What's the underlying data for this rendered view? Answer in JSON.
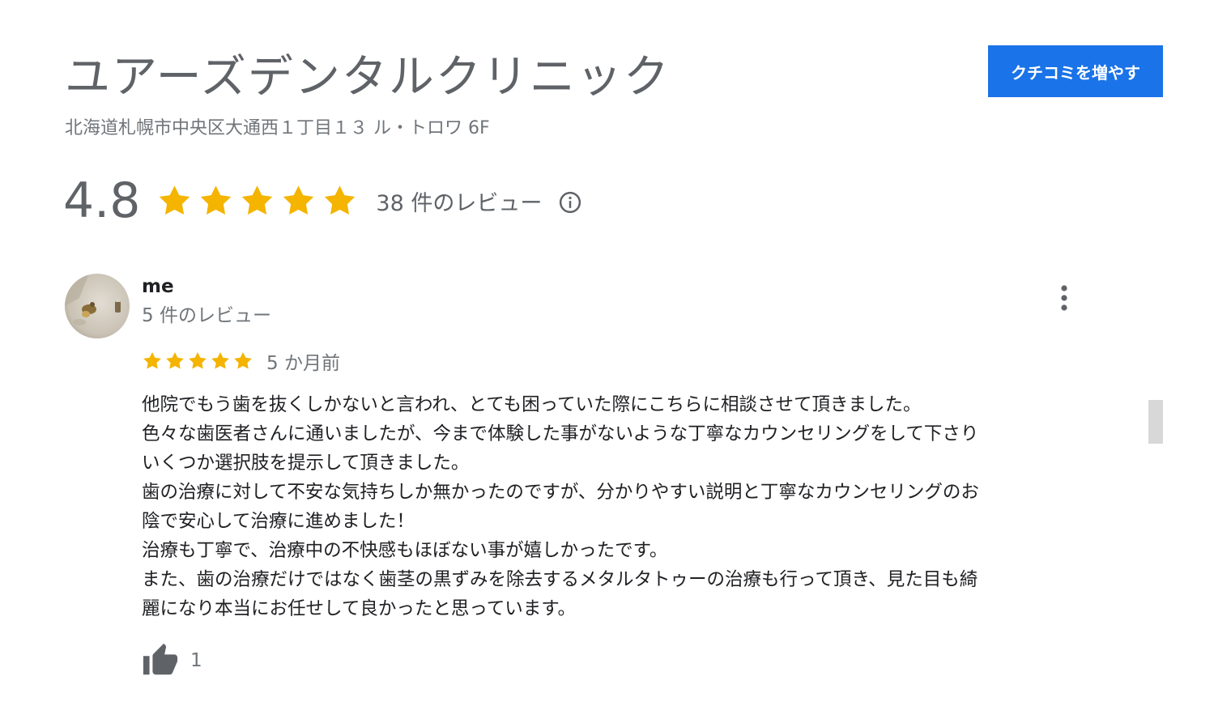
{
  "business": {
    "name": "ユアーズデンタルクリニック",
    "address": "北海道札幌市中央区大通西１丁目１３ ル・トロワ 6F"
  },
  "cta": {
    "label": "クチコミを増やす"
  },
  "rating": {
    "score": "4.8",
    "stars": 5,
    "review_count_label": "38 件のレビュー"
  },
  "review": {
    "author": "me",
    "author_meta": "5 件のレビュー",
    "stars": 5,
    "date": "5 か月前",
    "text": "他院でもう歯を抜くしかないと言われ、とても困っていた際にこちらに相談させて頂きました。\n色々な歯医者さんに通いましたが、今まで体験した事がないような丁寧なカウンセリングをして下さり\nいくつか選択肢を提示して頂きました。\n歯の治療に対して不安な気持ちしか無かったのですが、分かりやすい説明と丁寧なカウンセリングのお\n陰で安心して治療に進めました！\n治療も丁寧で、治療中の不快感もほぼない事が嬉しかったです。\nまた、歯の治療だけではなく歯茎の黒ずみを除去するメタルタトゥーの治療も行って頂き、見た目も綺\n麗になり本当にお任せして良かったと思っています。",
    "likes": "1"
  },
  "colors": {
    "star": "#f4b400",
    "accent_button": "#1a73e8",
    "muted_text": "#70757a",
    "icon_gray": "#5f6368"
  },
  "icons": {
    "info": "info-icon",
    "more": "more-vert-icon",
    "like": "thumb-up-icon",
    "star": "star-icon"
  }
}
